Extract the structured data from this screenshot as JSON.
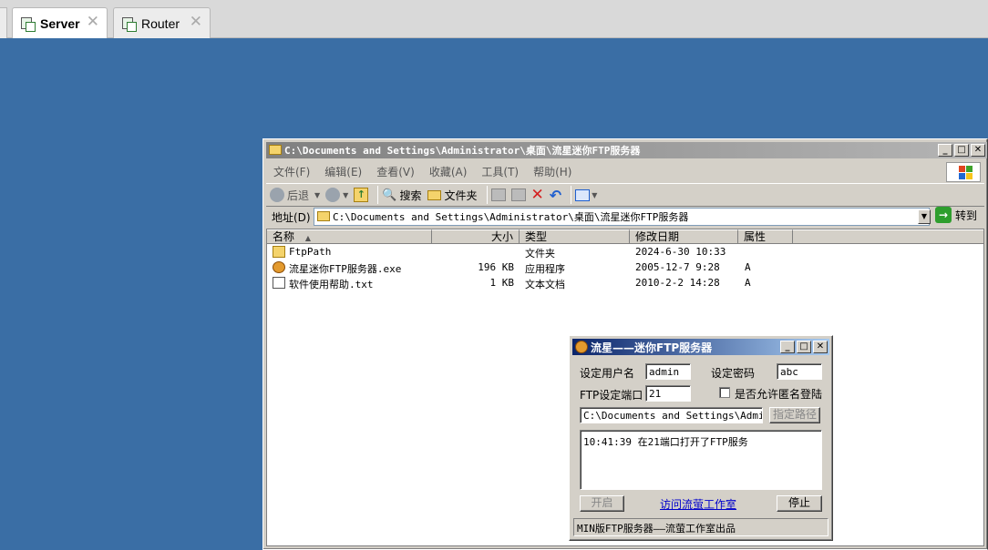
{
  "host_tabs": [
    {
      "label": "Server",
      "active": true
    },
    {
      "label": "Router",
      "active": false
    }
  ],
  "explorer": {
    "title": "C:\\Documents and Settings\\Administrator\\桌面\\流星迷你FTP服务器",
    "menu": [
      "文件(F)",
      "编辑(E)",
      "查看(V)",
      "收藏(A)",
      "工具(T)",
      "帮助(H)"
    ],
    "toolbar": {
      "back": "后退",
      "search": "搜索",
      "folders": "文件夹"
    },
    "address_label": "地址(D)",
    "address_value": "C:\\Documents and Settings\\Administrator\\桌面\\流星迷你FTP服务器",
    "go_label": "转到",
    "columns": [
      "名称",
      "大小",
      "类型",
      "修改日期",
      "属性"
    ],
    "files": [
      {
        "name": "FtpPath",
        "size": "",
        "type": "文件夹",
        "modified": "2024-6-30 10:33",
        "attr": "",
        "icon": "folder-icon"
      },
      {
        "name": "流星迷你FTP服务器.exe",
        "size": "196 KB",
        "type": "应用程序",
        "modified": "2005-12-7 9:28",
        "attr": "A",
        "icon": "app-icon"
      },
      {
        "name": "软件使用帮助.txt",
        "size": "1 KB",
        "type": "文本文档",
        "modified": "2010-2-2 14:28",
        "attr": "A",
        "icon": "text-file-icon"
      }
    ]
  },
  "ftp": {
    "title": "流星——迷你FTP服务器",
    "username_label": "设定用户名",
    "username_value": "admin",
    "password_label": "设定密码",
    "password_value": "abc",
    "port_label": "FTP设定端口",
    "port_value": "21",
    "anonymous_label": "是否允许匿名登陆",
    "path_value": "C:\\Documents and Settings\\Adminis",
    "path_button": "指定路径",
    "log": "10:41:39  在21端口打开了FTP服务",
    "start_button": "开启",
    "link": "访问流萤工作室",
    "stop_button": "停止",
    "status": "MIN版FTP服务器——流萤工作室出品"
  }
}
